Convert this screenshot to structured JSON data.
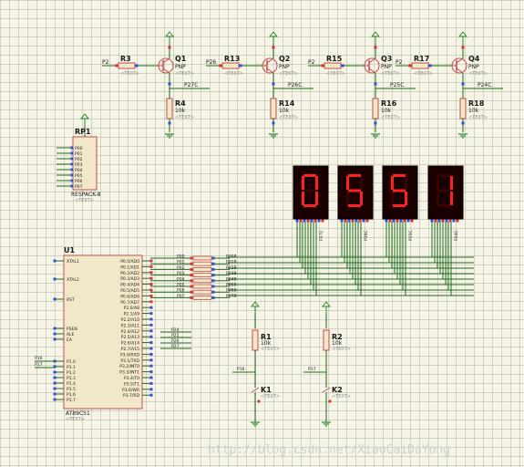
{
  "transistors": [
    {
      "ref": "Q1",
      "type": "PNP",
      "base_res": "R3",
      "base_net": "P2",
      "col_res": "R4",
      "col_val": "10k",
      "out_net": "P27C"
    },
    {
      "ref": "Q2",
      "type": "PNP",
      "base_res": "R13",
      "base_net": "P26",
      "col_res": "R14",
      "col_val": "10k",
      "out_net": "P26C"
    },
    {
      "ref": "Q3",
      "type": "PNP",
      "base_res": "R15",
      "base_net": "P2",
      "col_res": "R16",
      "col_val": "10k",
      "out_net": "P25C"
    },
    {
      "ref": "Q4",
      "type": "PNP",
      "base_res": "R17",
      "base_net": "P2",
      "col_res": "R18",
      "col_val": "10k",
      "out_net": "P24C"
    }
  ],
  "displays": [
    {
      "digit": "0",
      "net": "P27C"
    },
    {
      "digit": "5",
      "net": "P26C"
    },
    {
      "digit": "5",
      "net": "P25C"
    },
    {
      "digit": "1",
      "net": "P24C"
    }
  ],
  "rp1": {
    "ref": "RP1",
    "part": "RESPACK-8",
    "pins": [
      "P00",
      "P01",
      "P02",
      "P03",
      "P04",
      "P05",
      "P06",
      "P07"
    ]
  },
  "u1": {
    "ref": "U1",
    "part": "AT89C51",
    "left_pins": [
      "XTAL1",
      "XTAL2",
      "RST",
      "PSEN",
      "ALE",
      "EA",
      "P1.0",
      "P1.1",
      "P1.2",
      "P1.3",
      "P1.4",
      "P1.5",
      "P1.6",
      "P1.7"
    ],
    "right_pins": [
      "P0.0/AD0",
      "P0.1/AD1",
      "P0.2/AD2",
      "P0.3/AD3",
      "P0.4/AD4",
      "P0.5/AD5",
      "P0.6/AD6",
      "P0.7/AD7",
      "P2.0/A8",
      "P2.1/A9",
      "P2.2/A10",
      "P2.3/A11",
      "P2.4/A12",
      "P2.5/A13",
      "P2.6/A14",
      "P2.7/A15",
      "P3.0/RXD",
      "P3.1/TXD",
      "P3.2/INT0",
      "P3.3/INT1",
      "P3.4/T0",
      "P3.5/T1",
      "P3.6/WR",
      "P3.7/RD"
    ],
    "left_nets": [
      "P16",
      "P17"
    ],
    "p2_nets": [
      "P24",
      "P25",
      "P26",
      "P27"
    ]
  },
  "bus": {
    "in": [
      "P00",
      "P01",
      "P02",
      "P03",
      "P04",
      "P05",
      "P06",
      "P07"
    ],
    "out": [
      "P00B",
      "P01B",
      "P02B",
      "P03B",
      "P04B",
      "P05B",
      "P06B",
      "P07B"
    ]
  },
  "buttons": [
    {
      "res": "R1",
      "val": "10k",
      "net": "P16",
      "key": "K1"
    },
    {
      "res": "R2",
      "val": "10k",
      "net": "P17",
      "key": "K2"
    }
  ],
  "common": {
    "text_tag": "<TEXT>"
  },
  "watermark": "http://blog.csdn.net/XiaoCaiDaYong",
  "colors": {
    "wire": "#1e6b1e",
    "body": "#c0504d",
    "body_fill": "#f2e8c9",
    "display_bg": "#1a0000",
    "segment": "#ff2020",
    "power": "#2a8a2a"
  }
}
